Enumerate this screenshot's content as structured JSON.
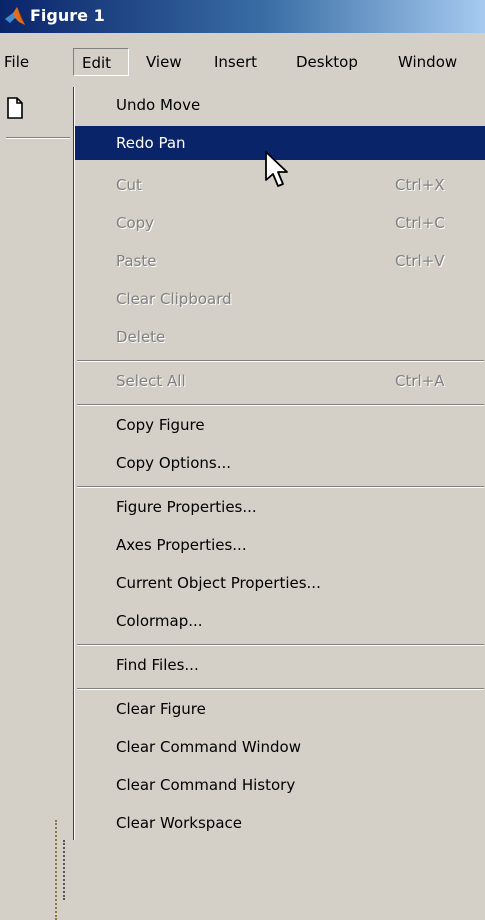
{
  "window": {
    "title": "Figure 1"
  },
  "menubar": {
    "items": [
      {
        "label": "File"
      },
      {
        "label": "Edit"
      },
      {
        "label": "View"
      },
      {
        "label": "Insert"
      },
      {
        "label": "Desktop"
      },
      {
        "label": "Window"
      }
    ],
    "open_menu": "Edit"
  },
  "toolbar": {
    "new_icon": "new-document-icon"
  },
  "edit_menu": {
    "items": [
      {
        "label": "Undo Move",
        "shortcut": "",
        "enabled": true
      },
      {
        "label": "Redo Pan",
        "shortcut": "",
        "enabled": true,
        "highlighted": true
      },
      {
        "label": "Cut",
        "shortcut": "Ctrl+X",
        "enabled": false
      },
      {
        "label": "Copy",
        "shortcut": "Ctrl+C",
        "enabled": false
      },
      {
        "label": "Paste",
        "shortcut": "Ctrl+V",
        "enabled": false
      },
      {
        "label": "Clear Clipboard",
        "shortcut": "",
        "enabled": false
      },
      {
        "label": "Delete",
        "shortcut": "",
        "enabled": false
      },
      {
        "label": "Select All",
        "shortcut": "Ctrl+A",
        "enabled": false
      },
      {
        "label": "Copy Figure",
        "shortcut": "",
        "enabled": true
      },
      {
        "label": "Copy Options...",
        "shortcut": "",
        "enabled": true
      },
      {
        "label": "Figure Properties...",
        "shortcut": "",
        "enabled": true
      },
      {
        "label": "Axes Properties...",
        "shortcut": "",
        "enabled": true
      },
      {
        "label": "Current Object Properties...",
        "shortcut": "",
        "enabled": true
      },
      {
        "label": "Colormap...",
        "shortcut": "",
        "enabled": true
      },
      {
        "label": "Find Files...",
        "shortcut": "",
        "enabled": true
      },
      {
        "label": "Clear Figure",
        "shortcut": "",
        "enabled": true
      },
      {
        "label": "Clear Command Window",
        "shortcut": "",
        "enabled": true
      },
      {
        "label": "Clear Command History",
        "shortcut": "",
        "enabled": true
      },
      {
        "label": "Clear Workspace",
        "shortcut": "",
        "enabled": true
      }
    ]
  },
  "colors": {
    "menu_bg": "#d4d0c8",
    "highlight": "#0a246a",
    "disabled_text": "#808080",
    "title_gradient_start": "#0a246a"
  },
  "cursor": {
    "icon": "arrow-cursor-icon"
  }
}
